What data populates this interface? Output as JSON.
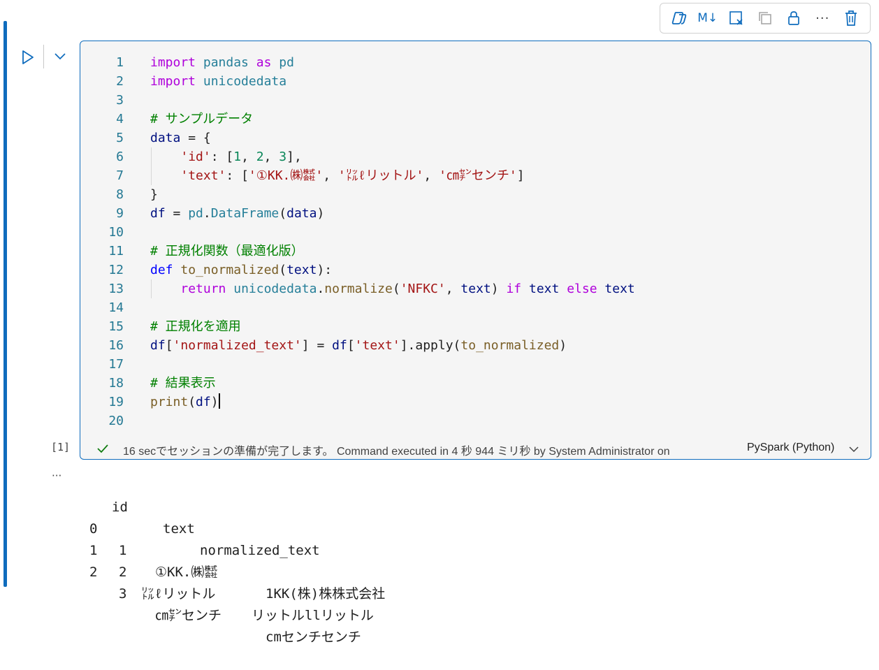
{
  "toolbar": {
    "icons": [
      "copilot-icon",
      "markdown-icon",
      "clear-output-icon",
      "copy-icon",
      "lock-icon",
      "more-icon",
      "delete-icon"
    ],
    "markdown_label": "M↓",
    "more_label": "···"
  },
  "code_lines": [
    {
      "n": "1"
    },
    {
      "n": "2"
    },
    {
      "n": "3"
    },
    {
      "n": "4",
      "comment": "# サンプルデータ"
    },
    {
      "n": "5"
    },
    {
      "n": "6"
    },
    {
      "n": "7",
      "strings": [
        "'①KK.㈱㍿'",
        "'㍑ℓリットル'",
        "'㎝㌢センチ'"
      ]
    },
    {
      "n": "8"
    },
    {
      "n": "9"
    },
    {
      "n": "10"
    },
    {
      "n": "11",
      "comment": "# 正規化関数（最適化版）"
    },
    {
      "n": "12"
    },
    {
      "n": "13"
    },
    {
      "n": "14"
    },
    {
      "n": "15",
      "comment": "# 正規化を適用"
    },
    {
      "n": "16"
    },
    {
      "n": "17"
    },
    {
      "n": "18",
      "comment": "# 結果表示"
    },
    {
      "n": "19"
    },
    {
      "n": "20"
    }
  ],
  "status": {
    "message": "16 secでセッションの準備が完了します。 Command executed in 4 秒 944 ミリ秒 by System Administrator on",
    "language": "PySpark (Python)"
  },
  "execution_count": "[1]",
  "output_more": "···",
  "output": {
    "header": [
      "id",
      "text",
      "normalized_text"
    ],
    "rows": [
      {
        "index": "0",
        "id": "1",
        "text": "①KK.㈱㍿",
        "normalized": "1KK(株)株株式会社"
      },
      {
        "index": "1",
        "id": "2",
        "text": "㍑ℓリットル",
        "normalized": "リットルllリットル"
      },
      {
        "index": "2",
        "id": "3",
        "text": "㎝㌢センチ",
        "normalized": "cmセンチセンチ"
      }
    ]
  },
  "colors": {
    "accent": "#0f6cbd",
    "keyword": "#af00db",
    "string": "#a31515",
    "comment": "#008000",
    "number": "#098658"
  }
}
